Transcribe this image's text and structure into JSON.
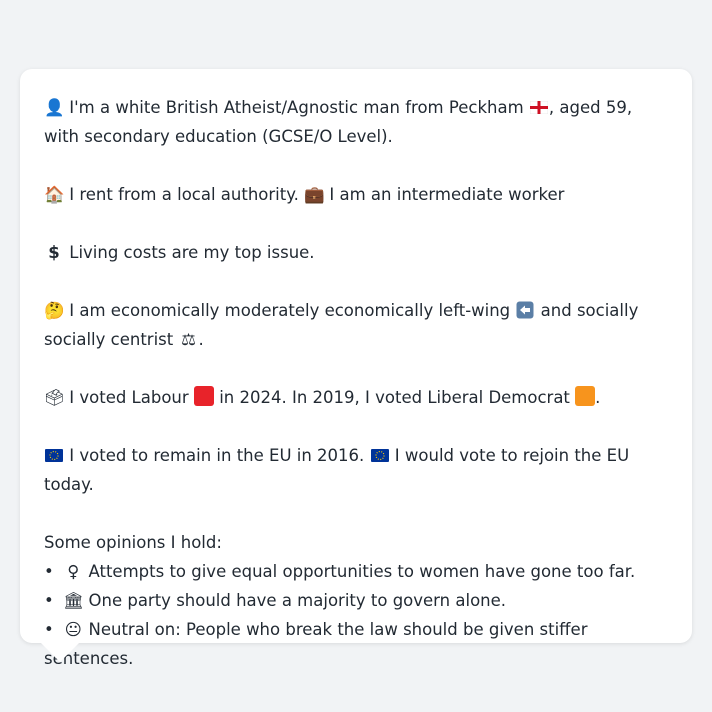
{
  "colors": {
    "labour_red": "#e8232a",
    "libdem_orange": "#f7941d",
    "background": "#f1f3f5",
    "card": "#ffffff"
  },
  "profile": {
    "line1": {
      "icon": "person-silhouette-icon",
      "text_a": "I'm a white British Atheist/Agnostic man from Peckham",
      "flag_icon": "england-flag-icon",
      "text_b": ", aged 59, with secondary education (GCSE/O Level)."
    },
    "line2": {
      "house_icon": "house-icon",
      "text_a": "I rent from a local authority.",
      "briefcase_icon": "briefcase-icon",
      "text_b": "I am an intermediate worker"
    },
    "line3": {
      "icon": "dollar-sign-icon",
      "text": "Living costs are my top issue."
    },
    "line4": {
      "icon": "thinking-face-icon",
      "text_a": "I am economically moderately economically left-wing",
      "left_icon": "left-arrow-icon",
      "text_b": "and socially socially centrist",
      "scales_icon": "balance-scale-icon",
      "text_c": "."
    },
    "line5": {
      "icon": "ballot-box-icon",
      "text_a": "I voted Labour",
      "text_b": "in 2024. In 2019, I voted Liberal Democrat",
      "text_c": "."
    },
    "line6": {
      "icon": "eu-flag-icon",
      "text_a": "I voted to remain in the EU in 2016.",
      "text_b": "I would vote to rejoin the EU today."
    }
  },
  "opinions": {
    "heading": "Some opinions I hold:",
    "items": [
      {
        "icon": "female-sign-icon",
        "text": "Attempts to give equal opportunities to women have gone too far."
      },
      {
        "icon": "classical-building-icon",
        "text": "One party should have a majority to govern alone."
      },
      {
        "icon": "neutral-face-icon",
        "text": "Neutral on: People who break the law should be given stiffer sentences."
      }
    ]
  }
}
